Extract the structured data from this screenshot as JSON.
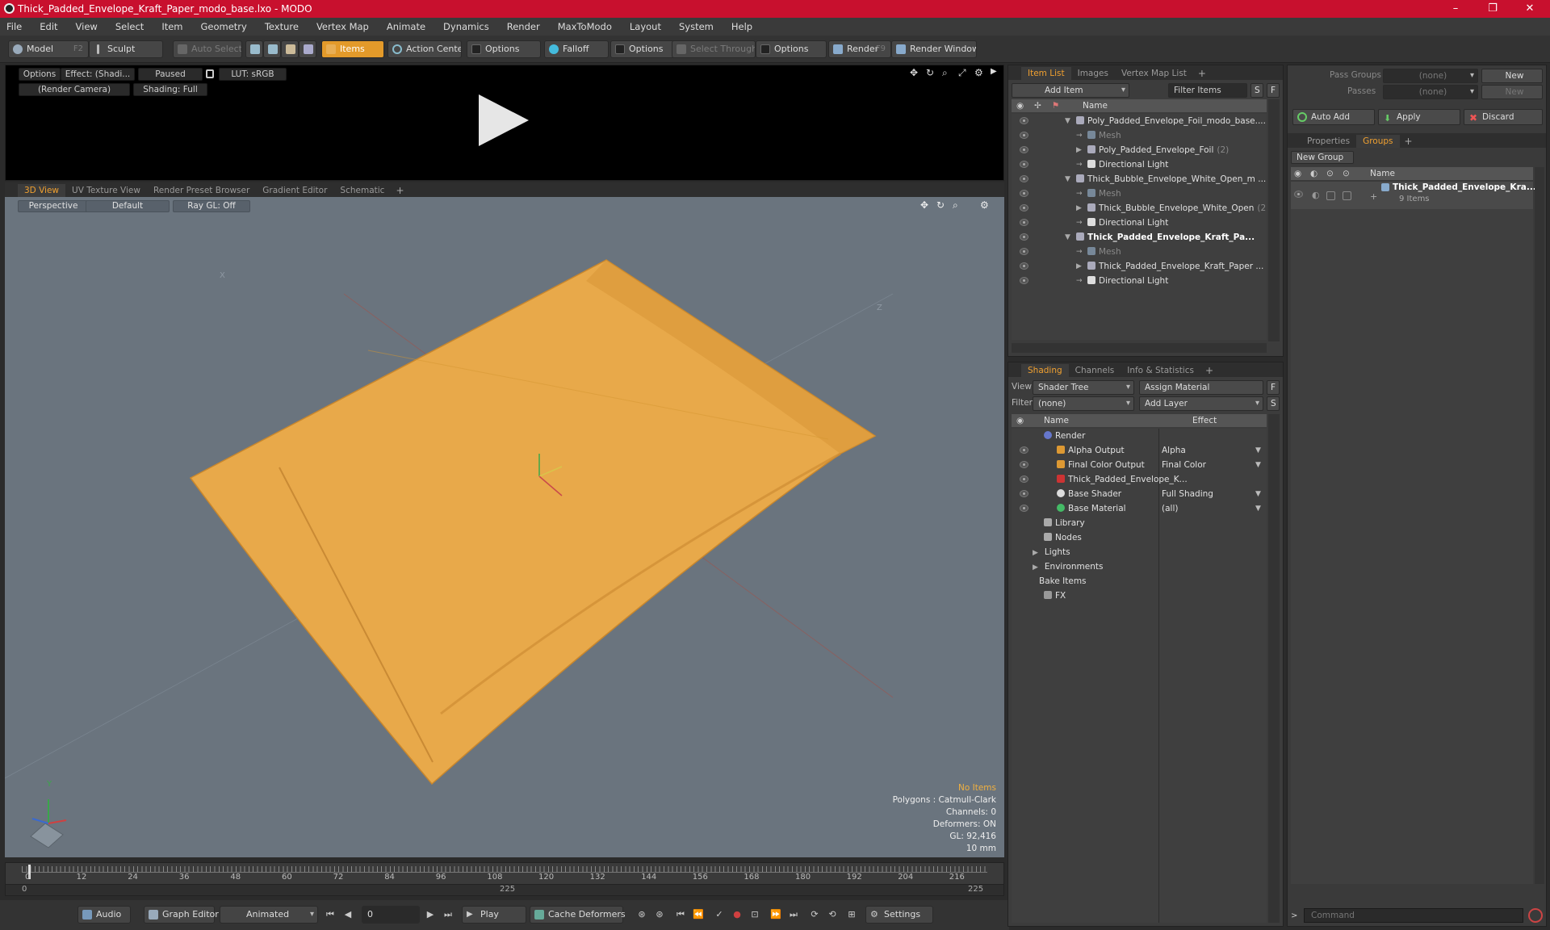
{
  "window": {
    "title": "Thick_Padded_Envelope_Kraft_Paper_modo_base.lxo - MODO",
    "controls": [
      "–",
      "❐",
      "✕"
    ]
  },
  "menu": [
    "File",
    "Edit",
    "View",
    "Select",
    "Item",
    "Geometry",
    "Texture",
    "Vertex Map",
    "Animate",
    "Dynamics",
    "Render",
    "MaxToModo",
    "Layout",
    "System",
    "Help"
  ],
  "toolbar": {
    "model": "Model",
    "model_key": "F2",
    "sculpt": "Sculpt",
    "auto_select": "Auto Select",
    "items": "Items",
    "action_center": "Action Center",
    "options1": "Options",
    "falloff": "Falloff",
    "options2": "Options",
    "select_through": "Select Through",
    "options3": "Options",
    "render": "Render",
    "render_key": "F9",
    "render_window": "Render Window"
  },
  "preview": {
    "options": "Options",
    "effect": "Effect: (Shadi...",
    "paused": "Paused",
    "lut": "LUT: sRGB",
    "camera": "(Render Camera)",
    "shading": "Shading: Full"
  },
  "viewport_tabs": [
    "3D View",
    "UV Texture View",
    "Render Preset Browser",
    "Gradient Editor",
    "Schematic"
  ],
  "viewport": {
    "perspective": "Perspective",
    "default": "Default",
    "raygl": "Ray GL: Off",
    "info": {
      "no_items": "No Items",
      "polygons": "Polygons : Catmull-Clark",
      "channels": "Channels: 0",
      "deformers": "Deformers: ON",
      "gl": "GL: 92,416",
      "unit": "10 mm"
    },
    "axis_x": "X",
    "axis_z": "Z",
    "gizmo_y": "Y"
  },
  "timeline": {
    "ticks": [
      "0",
      "12",
      "24",
      "36",
      "48",
      "60",
      "72",
      "84",
      "96",
      "108",
      "120",
      "132",
      "144",
      "156",
      "168",
      "180",
      "192",
      "204",
      "216"
    ],
    "start": "0",
    "mid": "225",
    "end": "225"
  },
  "bottom": {
    "audio": "Audio",
    "graph_editor": "Graph Editor",
    "animated": "Animated",
    "frame": "0",
    "play": "Play",
    "cache": "Cache Deformers",
    "settings": "Settings"
  },
  "item_list": {
    "tabs": [
      "Item List",
      "Images",
      "Vertex Map List"
    ],
    "add_item": "Add Item",
    "filter_items": "Filter Items",
    "s_btn": "S",
    "f_btn": "F",
    "col_name": "Name",
    "rows": [
      {
        "label": "Poly_Padded_Envelope_Foil_modo_base....",
        "indent": 0,
        "style": "normal"
      },
      {
        "label": "Mesh",
        "indent": 1,
        "style": "dim"
      },
      {
        "label": "Poly_Padded_Envelope_Foil",
        "suffix": "(2)",
        "indent": 1,
        "style": "normal"
      },
      {
        "label": "Directional Light",
        "indent": 1,
        "style": "normal"
      },
      {
        "label": "Thick_Bubble_Envelope_White_Open_m ...",
        "indent": 0,
        "style": "normal"
      },
      {
        "label": "Mesh",
        "indent": 1,
        "style": "dim"
      },
      {
        "label": "Thick_Bubble_Envelope_White_Open",
        "suffix": "(2)",
        "indent": 1,
        "style": "normal"
      },
      {
        "label": "Directional Light",
        "indent": 1,
        "style": "normal"
      },
      {
        "label": "Thick_Padded_Envelope_Kraft_Pa...",
        "indent": 0,
        "style": "bold"
      },
      {
        "label": "Mesh",
        "indent": 1,
        "style": "dim"
      },
      {
        "label": "Thick_Padded_Envelope_Kraft_Paper ...",
        "indent": 1,
        "style": "normal"
      },
      {
        "label": "Directional Light",
        "indent": 1,
        "style": "normal"
      }
    ]
  },
  "shading": {
    "tabs": [
      "Shading",
      "Channels",
      "Info & Statistics"
    ],
    "view_label": "View",
    "view_value": "Shader Tree",
    "assign_material": "Assign Material",
    "filter_label": "Filter",
    "filter_value": "(none)",
    "add_layer": "Add Layer",
    "f_btn": "F",
    "s_btn": "S",
    "col_name": "Name",
    "col_effect": "Effect",
    "rows": [
      {
        "label": "Render",
        "effect": "",
        "indent": 0
      },
      {
        "label": "Alpha Output",
        "effect": "Alpha",
        "indent": 1
      },
      {
        "label": "Final Color Output",
        "effect": "Final Color",
        "indent": 1
      },
      {
        "label": "Thick_Padded_Envelope_K...",
        "effect": "",
        "indent": 1
      },
      {
        "label": "Base Shader",
        "effect": "Full Shading",
        "indent": 1
      },
      {
        "label": "Base Material",
        "effect": "(all)",
        "indent": 1
      },
      {
        "label": "Library",
        "effect": "",
        "indent": 0
      },
      {
        "label": "Nodes",
        "effect": "",
        "indent": 0
      },
      {
        "label": "Lights",
        "effect": "",
        "indent": -1
      },
      {
        "label": "Environments",
        "effect": "",
        "indent": -1
      },
      {
        "label": "Bake Items",
        "effect": "",
        "indent": -1
      },
      {
        "label": "FX",
        "effect": "",
        "indent": 0
      }
    ]
  },
  "right": {
    "pass_groups_label": "Pass Groups",
    "pass_groups_value": "(none)",
    "passes_label": "Passes",
    "passes_value": "(none)",
    "new1": "New",
    "new2": "New",
    "auto_add": "Auto Add",
    "apply": "Apply",
    "discard": "Discard",
    "tabs": [
      "Properties",
      "Groups"
    ],
    "new_group": "New Group",
    "col_name": "Name",
    "group_name": "Thick_Padded_Envelope_Kra...",
    "group_count": "9 Items",
    "command_placeholder": "Command"
  },
  "colors": {
    "accent": "#e39a2a",
    "titlebar": "#c8102e",
    "envelope": "#e8a94a",
    "viewport_bg": "#6a747e"
  }
}
